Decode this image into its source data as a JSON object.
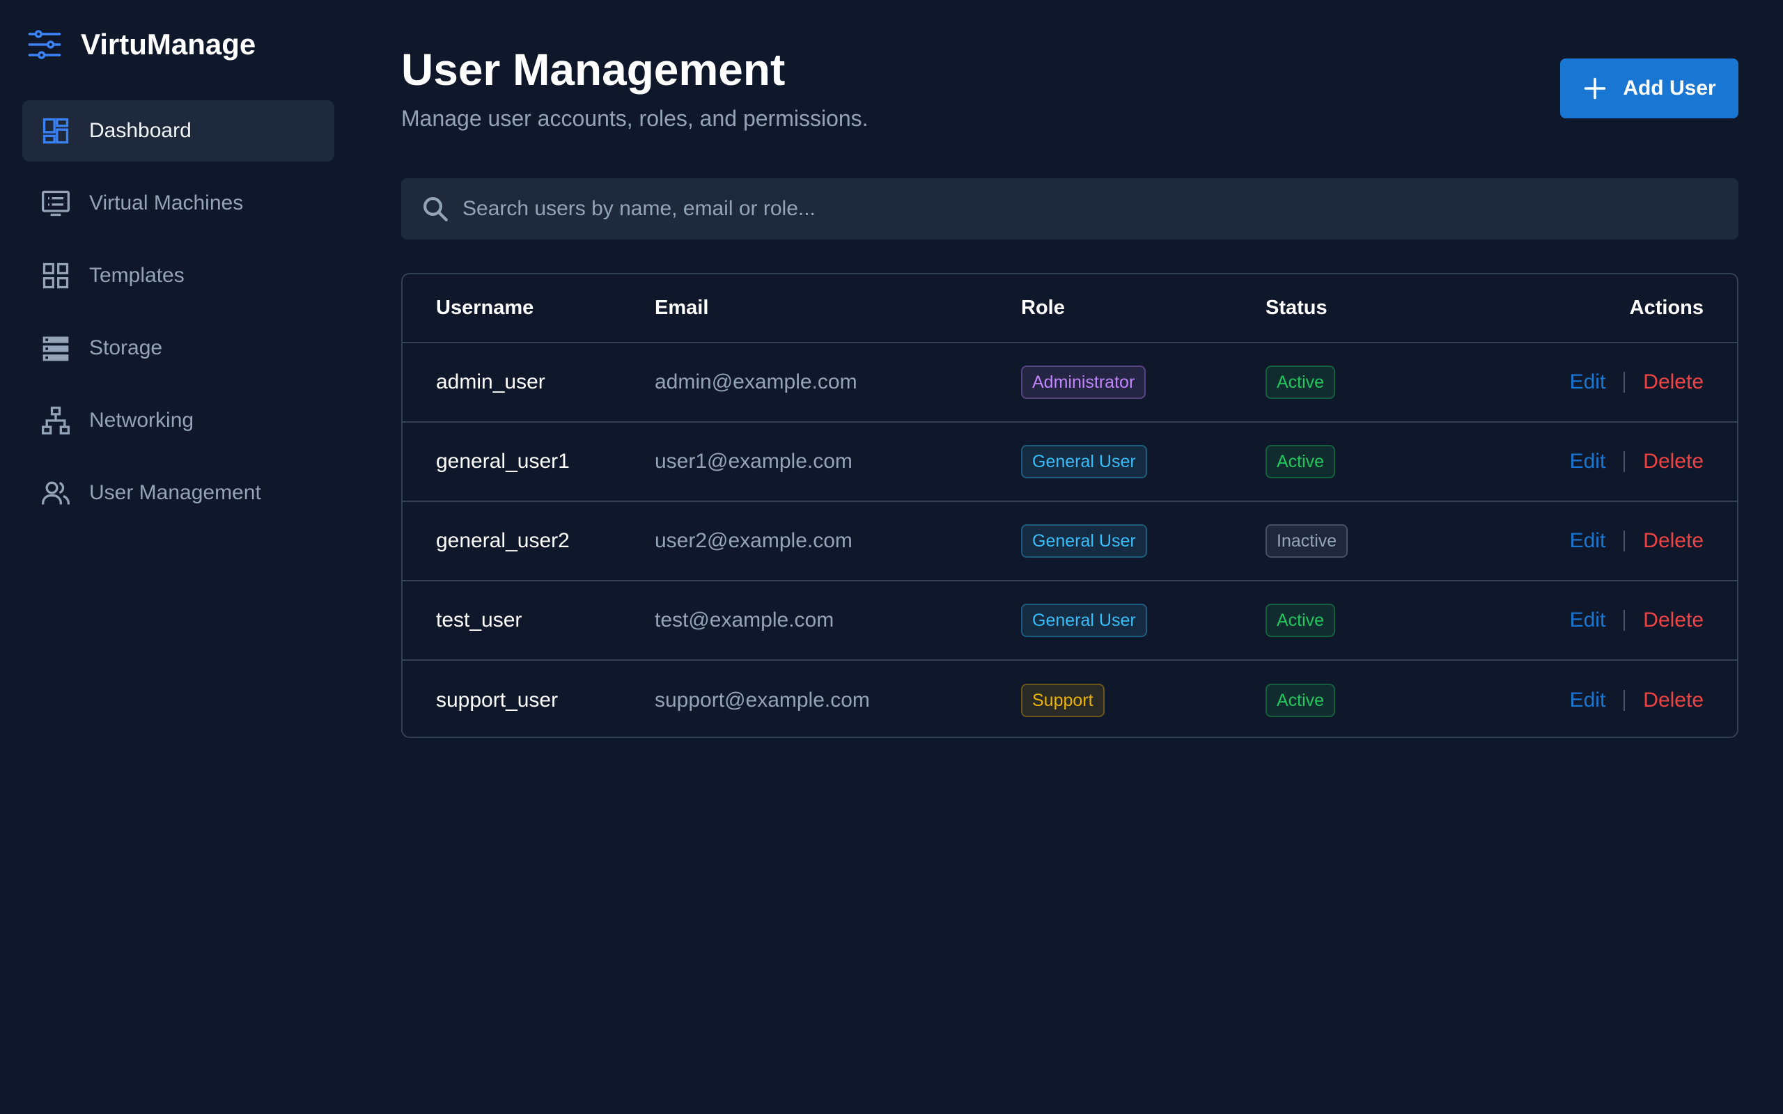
{
  "app": {
    "name": "VirtuManage",
    "logo_icon": "sliders-icon"
  },
  "sidebar": {
    "items": [
      {
        "label": "Dashboard",
        "icon": "dashboard-icon",
        "active": true
      },
      {
        "label": "Virtual Machines",
        "icon": "monitor-list-icon",
        "active": false
      },
      {
        "label": "Templates",
        "icon": "grid-icon",
        "active": false
      },
      {
        "label": "Storage",
        "icon": "storage-icon",
        "active": false
      },
      {
        "label": "Networking",
        "icon": "network-icon",
        "active": false
      },
      {
        "label": "User Management",
        "icon": "users-icon",
        "active": false
      }
    ]
  },
  "header": {
    "title": "User Management",
    "subtitle": "Manage user accounts, roles, and permissions.",
    "add_button_label": "Add User"
  },
  "search": {
    "placeholder": "Search users by name, email or role...",
    "value": ""
  },
  "table": {
    "columns": {
      "username": "Username",
      "email": "Email",
      "role": "Role",
      "status": "Status",
      "actions": "Actions"
    },
    "rows": [
      {
        "username": "admin_user",
        "email": "admin@example.com",
        "role": "Administrator",
        "role_color": "#c084fc",
        "status": "Active",
        "status_color": "#22c55e"
      },
      {
        "username": "general_user1",
        "email": "user1@example.com",
        "role": "General User",
        "role_color": "#38bdf8",
        "status": "Active",
        "status_color": "#22c55e"
      },
      {
        "username": "general_user2",
        "email": "user2@example.com",
        "role": "General User",
        "role_color": "#38bdf8",
        "status": "Inactive",
        "status_color": "#94a3b8"
      },
      {
        "username": "test_user",
        "email": "test@example.com",
        "role": "General User",
        "role_color": "#38bdf8",
        "status": "Active",
        "status_color": "#22c55e"
      },
      {
        "username": "support_user",
        "email": "support@example.com",
        "role": "Support",
        "role_color": "#eab308",
        "status": "Active",
        "status_color": "#22c55e"
      }
    ],
    "edit_label": "Edit",
    "delete_label": "Delete"
  },
  "colors": {
    "background": "#0f172a",
    "panel": "#1e293b",
    "accent": "#1976d2",
    "danger": "#ef4444"
  }
}
